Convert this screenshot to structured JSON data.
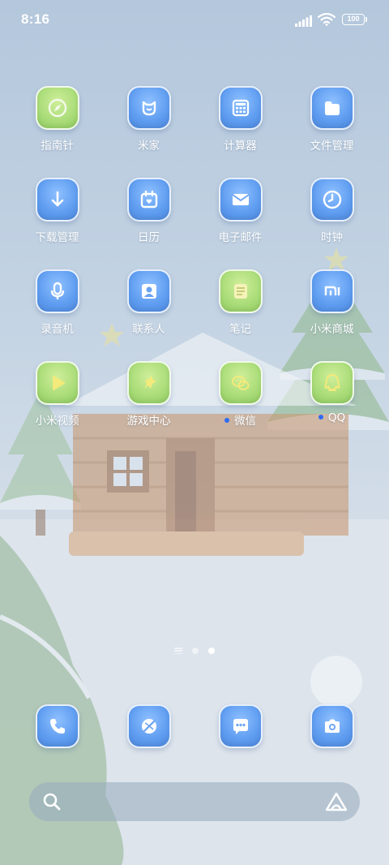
{
  "status_bar": {
    "time": "8:16",
    "battery": "100",
    "icons": [
      "signal-icon",
      "wifi-icon",
      "battery-icon"
    ]
  },
  "apps": [
    {
      "label": "指南针",
      "icon": "compass-icon",
      "color": "green"
    },
    {
      "label": "米家",
      "icon": "mi-home-icon",
      "color": "blue"
    },
    {
      "label": "计算器",
      "icon": "calculator-icon",
      "color": "blue"
    },
    {
      "label": "文件管理",
      "icon": "folder-icon",
      "color": "blue"
    },
    {
      "label": "下载管理",
      "icon": "download-icon",
      "color": "blue"
    },
    {
      "label": "日历",
      "icon": "calendar-icon",
      "color": "blue"
    },
    {
      "label": "电子邮件",
      "icon": "mail-icon",
      "color": "blue"
    },
    {
      "label": "时钟",
      "icon": "clock-icon",
      "color": "blue"
    },
    {
      "label": "录音机",
      "icon": "microphone-icon",
      "color": "blue"
    },
    {
      "label": "联系人",
      "icon": "contacts-icon",
      "color": "blue"
    },
    {
      "label": "笔记",
      "icon": "notes-icon",
      "color": "green"
    },
    {
      "label": "小米商城",
      "icon": "mi-store-icon",
      "color": "blue"
    },
    {
      "label": "小米视频",
      "icon": "video-play-icon",
      "color": "green"
    },
    {
      "label": "游戏中心",
      "icon": "game-center-icon",
      "color": "green"
    },
    {
      "label": "微信",
      "icon": "wechat-icon",
      "color": "green",
      "new_dot": true
    },
    {
      "label": "QQ",
      "icon": "qq-icon",
      "color": "green",
      "new_dot": true
    }
  ],
  "page_indicator": {
    "pages": 2,
    "active": 2
  },
  "dock": [
    {
      "icon": "phone-icon",
      "color": "blue"
    },
    {
      "icon": "browser-icon",
      "color": "blue"
    },
    {
      "icon": "messages-icon",
      "color": "blue"
    },
    {
      "icon": "camera-icon",
      "color": "blue"
    }
  ],
  "search": {
    "icon": "search-icon",
    "assistant_icon": "assistant-icon"
  },
  "colors": {
    "icon_blue": "#5e9cf0",
    "icon_green": "#a9dc78",
    "unread_dot": "#2f6cf0",
    "label": "#ffffff"
  }
}
